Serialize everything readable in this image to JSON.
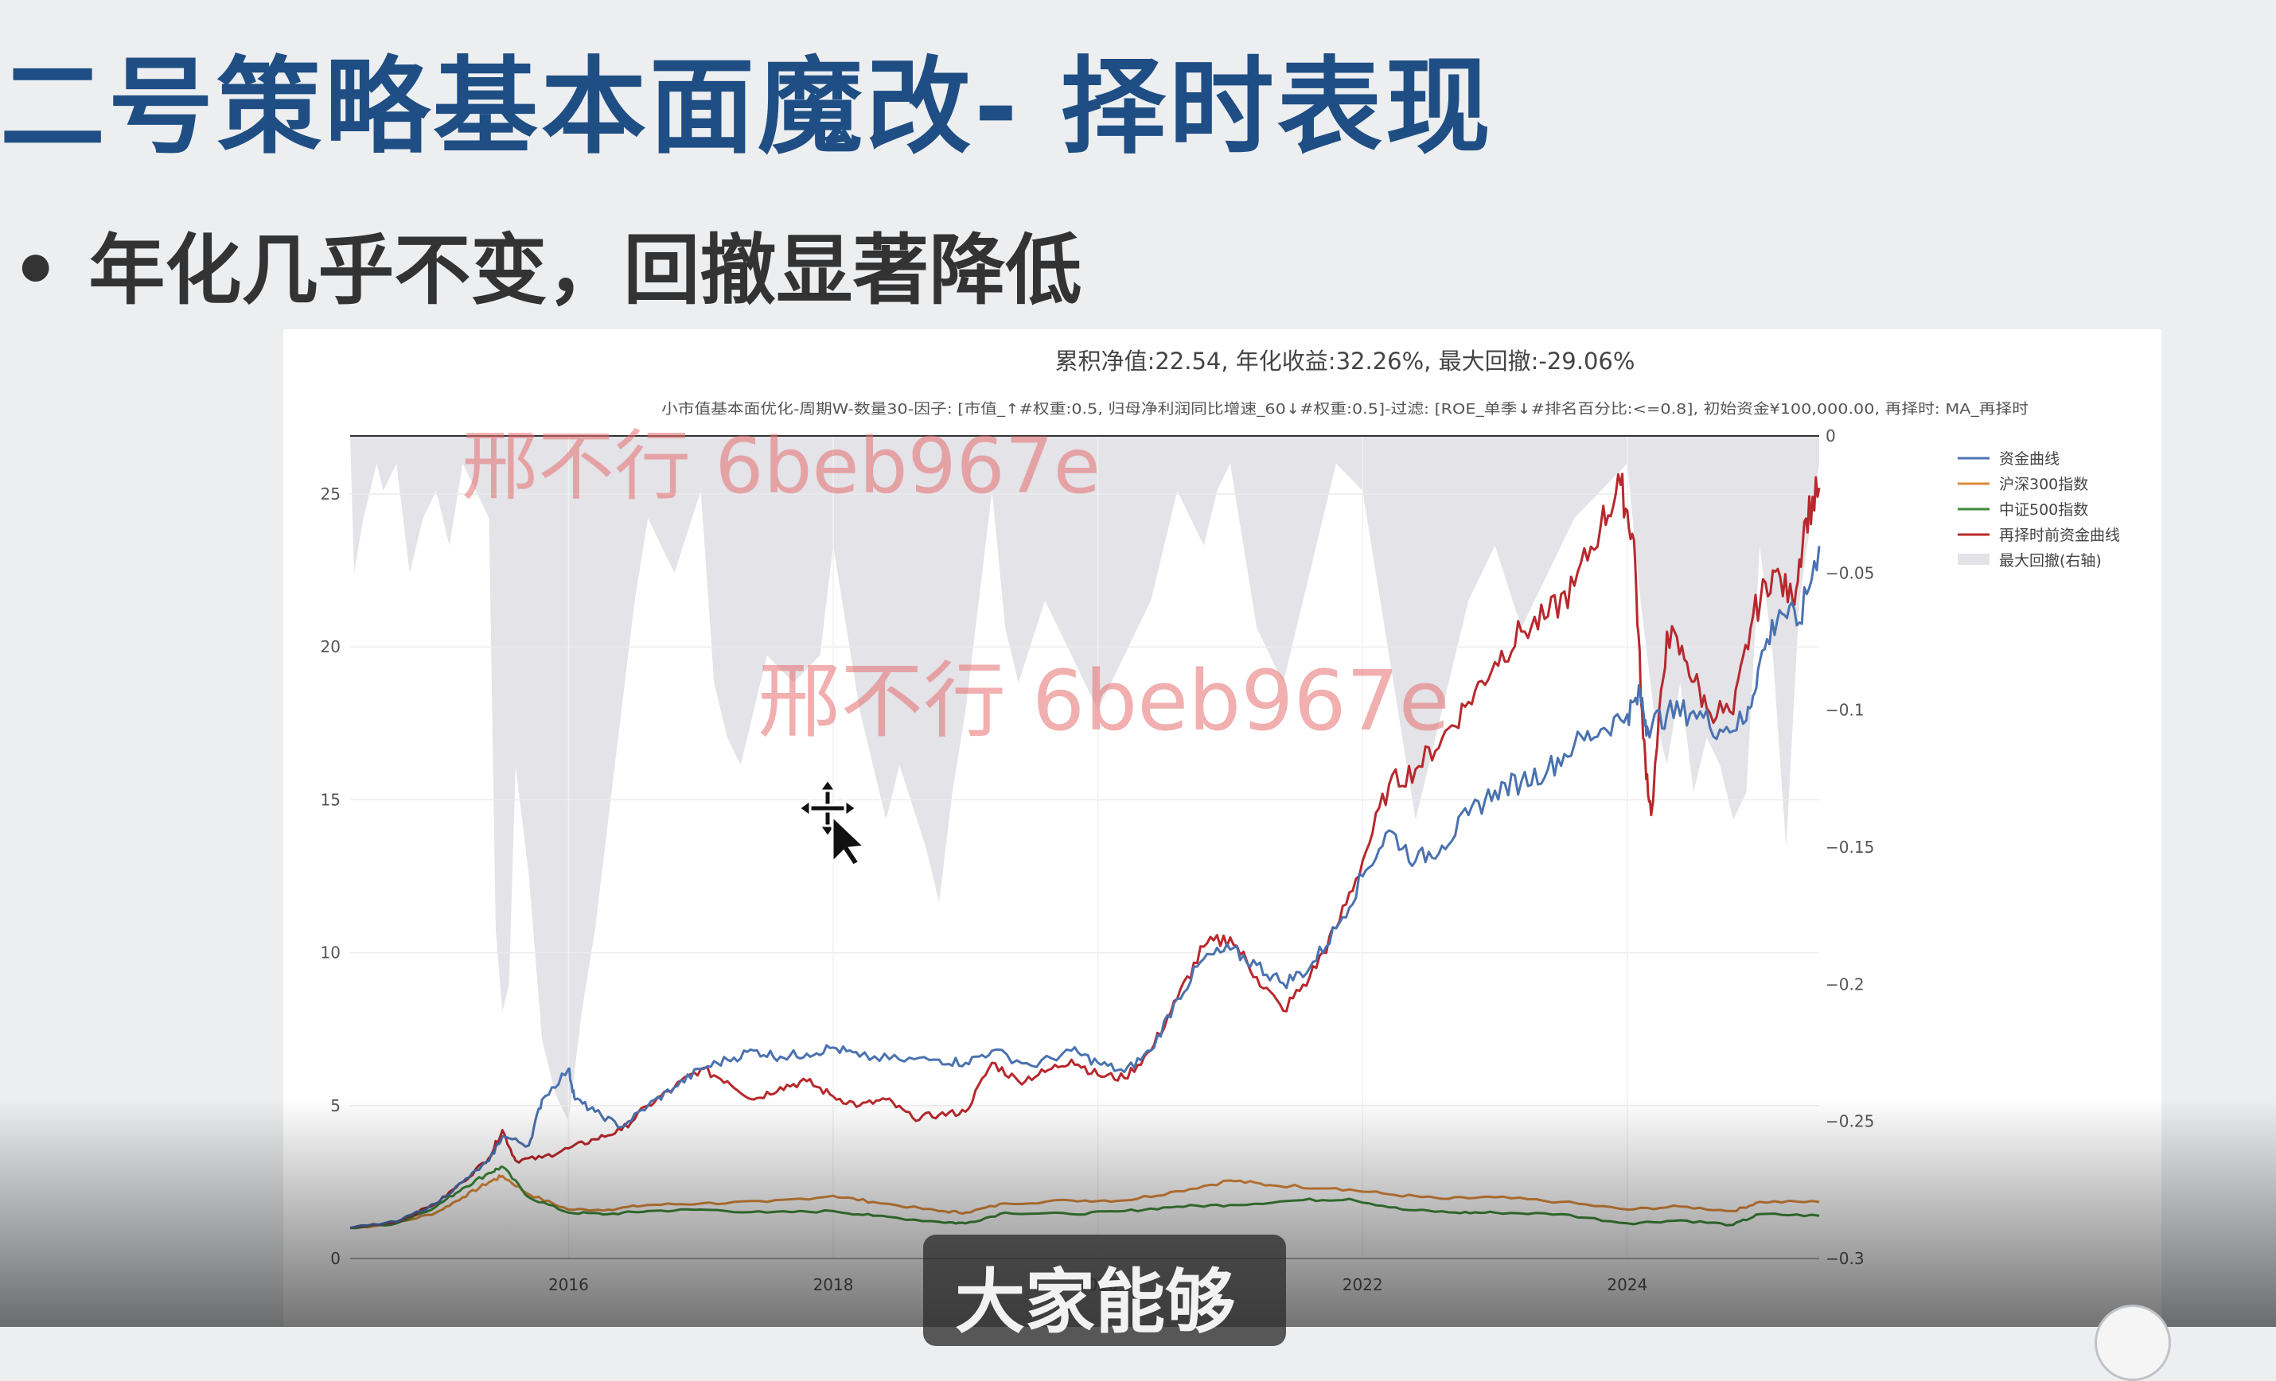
{
  "slide": {
    "title": "二号策略基本面魔改- 择时表现",
    "bullet": "年化几乎不变，回撤显著降低"
  },
  "watermark": "邢不行 6beb967e",
  "caption": "大家能够",
  "icons": {
    "cursor": "move-cursor-icon",
    "bullet": "bullet-dot-icon"
  },
  "chart_data": {
    "type": "line",
    "title": "累积净值:22.54, 年化收益:32.26%, 最大回撤:-29.06%",
    "subtitle": "小市值基本面优化-周期W-数量30-因子: [市值_↑#权重:0.5, 归母净利润同比增速_60↓#权重:0.5]-过滤: [ROE_单季↓#排名百分比:<=0.8], 初始资金¥100,000.00, 再择时: MA_再择时",
    "x_ticks": [
      "2016",
      "2018",
      "2020",
      "2022",
      "2024"
    ],
    "x_range": [
      2014.35,
      2025.45
    ],
    "y_left": {
      "ticks": [
        0,
        5,
        10,
        15,
        20,
        25
      ],
      "range": [
        0,
        26.9
      ]
    },
    "y_right": {
      "ticks": [
        0,
        -0.05,
        -0.1,
        -0.15,
        -0.2,
        -0.25,
        -0.3
      ],
      "range": [
        -0.3,
        0
      ]
    },
    "legend_position": "right",
    "legend": [
      "资金曲线",
      "沪深300指数",
      "中证500指数",
      "再择时前资金曲线",
      "最大回撤(右轴)"
    ],
    "colors": {
      "资金曲线": "#4a72b0",
      "沪深300指数": "#dd8b3c",
      "中证500指数": "#3f8a3a",
      "再择时前资金曲线": "#b8282c",
      "最大回撤(右轴)": "#e3e3e8"
    },
    "series": [
      {
        "name": "资金曲线",
        "axis": "left",
        "points": [
          [
            2014.35,
            1.0
          ],
          [
            2014.7,
            1.2
          ],
          [
            2015.0,
            1.8
          ],
          [
            2015.2,
            2.5
          ],
          [
            2015.4,
            3.2
          ],
          [
            2015.5,
            4.0
          ],
          [
            2015.7,
            3.7
          ],
          [
            2015.8,
            5.2
          ],
          [
            2016.0,
            6.2
          ],
          [
            2016.05,
            5.2
          ],
          [
            2016.2,
            4.8
          ],
          [
            2016.4,
            4.3
          ],
          [
            2016.6,
            5.0
          ],
          [
            2016.8,
            5.6
          ],
          [
            2017.0,
            6.2
          ],
          [
            2017.2,
            6.5
          ],
          [
            2017.4,
            6.8
          ],
          [
            2017.6,
            6.6
          ],
          [
            2017.8,
            6.7
          ],
          [
            2018.0,
            6.9
          ],
          [
            2018.2,
            6.6
          ],
          [
            2018.5,
            6.5
          ],
          [
            2018.8,
            6.5
          ],
          [
            2019.0,
            6.4
          ],
          [
            2019.2,
            6.8
          ],
          [
            2019.5,
            6.3
          ],
          [
            2019.8,
            6.8
          ],
          [
            2020.0,
            6.4
          ],
          [
            2020.2,
            6.1
          ],
          [
            2020.4,
            6.8
          ],
          [
            2020.6,
            8.5
          ],
          [
            2020.8,
            9.8
          ],
          [
            2021.0,
            10.1
          ],
          [
            2021.2,
            9.6
          ],
          [
            2021.4,
            9.0
          ],
          [
            2021.6,
            9.5
          ],
          [
            2021.8,
            10.8
          ],
          [
            2022.0,
            12.5
          ],
          [
            2022.2,
            14.0
          ],
          [
            2022.4,
            13.0
          ],
          [
            2022.6,
            13.5
          ],
          [
            2022.8,
            14.5
          ],
          [
            2023.0,
            15.3
          ],
          [
            2023.2,
            15.6
          ],
          [
            2023.4,
            16.0
          ],
          [
            2023.6,
            16.8
          ],
          [
            2023.8,
            17.3
          ],
          [
            2024.0,
            17.8
          ],
          [
            2024.1,
            18.4
          ],
          [
            2024.15,
            17.4
          ],
          [
            2024.3,
            17.8
          ],
          [
            2024.5,
            17.9
          ],
          [
            2024.7,
            17.3
          ],
          [
            2024.9,
            17.6
          ],
          [
            2025.0,
            19.5
          ],
          [
            2025.15,
            21.2
          ],
          [
            2025.3,
            20.8
          ],
          [
            2025.45,
            23.3
          ]
        ]
      },
      {
        "name": "再择时前资金曲线",
        "axis": "left",
        "points": [
          [
            2014.35,
            1.0
          ],
          [
            2014.7,
            1.2
          ],
          [
            2015.0,
            1.8
          ],
          [
            2015.2,
            2.5
          ],
          [
            2015.4,
            3.3
          ],
          [
            2015.5,
            4.2
          ],
          [
            2015.6,
            3.2
          ],
          [
            2015.8,
            3.3
          ],
          [
            2016.0,
            3.6
          ],
          [
            2016.2,
            3.9
          ],
          [
            2016.4,
            4.2
          ],
          [
            2016.6,
            5.0
          ],
          [
            2016.8,
            5.6
          ],
          [
            2017.0,
            6.2
          ],
          [
            2017.2,
            5.8
          ],
          [
            2017.4,
            5.2
          ],
          [
            2017.6,
            5.6
          ],
          [
            2017.8,
            5.8
          ],
          [
            2018.0,
            5.3
          ],
          [
            2018.2,
            5.0
          ],
          [
            2018.4,
            5.2
          ],
          [
            2018.6,
            4.6
          ],
          [
            2018.8,
            4.7
          ],
          [
            2019.0,
            4.8
          ],
          [
            2019.2,
            6.4
          ],
          [
            2019.4,
            5.8
          ],
          [
            2019.6,
            6.1
          ],
          [
            2019.8,
            6.5
          ],
          [
            2020.0,
            6.0
          ],
          [
            2020.2,
            5.9
          ],
          [
            2020.4,
            6.8
          ],
          [
            2020.6,
            8.5
          ],
          [
            2020.8,
            10.2
          ],
          [
            2021.0,
            10.5
          ],
          [
            2021.2,
            9.2
          ],
          [
            2021.4,
            8.1
          ],
          [
            2021.6,
            9.2
          ],
          [
            2021.8,
            10.8
          ],
          [
            2022.0,
            13.0
          ],
          [
            2022.2,
            15.5
          ],
          [
            2022.4,
            16.0
          ],
          [
            2022.6,
            17.0
          ],
          [
            2022.8,
            18.2
          ],
          [
            2023.0,
            19.5
          ],
          [
            2023.2,
            20.5
          ],
          [
            2023.4,
            21.0
          ],
          [
            2023.6,
            22.0
          ],
          [
            2023.8,
            24.0
          ],
          [
            2023.95,
            25.3
          ],
          [
            2024.05,
            23.5
          ],
          [
            2024.12,
            17.0
          ],
          [
            2024.18,
            14.5
          ],
          [
            2024.3,
            20.5
          ],
          [
            2024.45,
            19.5
          ],
          [
            2024.6,
            18.0
          ],
          [
            2024.8,
            17.8
          ],
          [
            2024.95,
            21.0
          ],
          [
            2025.1,
            22.5
          ],
          [
            2025.25,
            21.5
          ],
          [
            2025.35,
            24.2
          ],
          [
            2025.45,
            25.2
          ]
        ]
      },
      {
        "name": "沪深300指数",
        "axis": "left",
        "points": [
          [
            2014.35,
            1.0
          ],
          [
            2014.7,
            1.15
          ],
          [
            2015.0,
            1.5
          ],
          [
            2015.2,
            2.0
          ],
          [
            2015.4,
            2.5
          ],
          [
            2015.5,
            2.7
          ],
          [
            2015.7,
            2.1
          ],
          [
            2016.0,
            1.6
          ],
          [
            2016.3,
            1.6
          ],
          [
            2016.6,
            1.75
          ],
          [
            2017.0,
            1.8
          ],
          [
            2017.5,
            1.85
          ],
          [
            2018.0,
            2.05
          ],
          [
            2018.3,
            1.85
          ],
          [
            2018.8,
            1.55
          ],
          [
            2019.0,
            1.5
          ],
          [
            2019.3,
            1.8
          ],
          [
            2019.8,
            1.9
          ],
          [
            2020.2,
            1.9
          ],
          [
            2020.6,
            2.2
          ],
          [
            2021.0,
            2.55
          ],
          [
            2021.3,
            2.4
          ],
          [
            2021.8,
            2.3
          ],
          [
            2022.2,
            2.1
          ],
          [
            2022.6,
            1.95
          ],
          [
            2023.0,
            2.0
          ],
          [
            2023.5,
            1.85
          ],
          [
            2024.0,
            1.6
          ],
          [
            2024.4,
            1.7
          ],
          [
            2024.8,
            1.55
          ],
          [
            2025.0,
            1.85
          ],
          [
            2025.45,
            1.85
          ]
        ]
      },
      {
        "name": "中证500指数",
        "axis": "left",
        "points": [
          [
            2014.35,
            1.0
          ],
          [
            2014.7,
            1.15
          ],
          [
            2015.0,
            1.7
          ],
          [
            2015.2,
            2.3
          ],
          [
            2015.4,
            2.8
          ],
          [
            2015.5,
            3.0
          ],
          [
            2015.7,
            2.0
          ],
          [
            2016.0,
            1.5
          ],
          [
            2016.3,
            1.45
          ],
          [
            2016.6,
            1.55
          ],
          [
            2017.0,
            1.6
          ],
          [
            2017.5,
            1.5
          ],
          [
            2018.0,
            1.55
          ],
          [
            2018.3,
            1.4
          ],
          [
            2018.8,
            1.2
          ],
          [
            2019.0,
            1.15
          ],
          [
            2019.3,
            1.5
          ],
          [
            2019.8,
            1.45
          ],
          [
            2020.2,
            1.55
          ],
          [
            2020.6,
            1.7
          ],
          [
            2021.0,
            1.75
          ],
          [
            2021.5,
            1.9
          ],
          [
            2021.9,
            1.95
          ],
          [
            2022.3,
            1.6
          ],
          [
            2022.7,
            1.5
          ],
          [
            2023.0,
            1.5
          ],
          [
            2023.5,
            1.45
          ],
          [
            2024.0,
            1.15
          ],
          [
            2024.4,
            1.25
          ],
          [
            2024.8,
            1.1
          ],
          [
            2025.0,
            1.45
          ],
          [
            2025.45,
            1.4
          ]
        ]
      }
    ],
    "drawdown": [
      [
        2014.35,
        0
      ],
      [
        2014.38,
        -0.05
      ],
      [
        2014.45,
        -0.03
      ],
      [
        2014.55,
        -0.01
      ],
      [
        2014.6,
        -0.02
      ],
      [
        2014.7,
        -0.01
      ],
      [
        2014.8,
        -0.05
      ],
      [
        2014.9,
        -0.03
      ],
      [
        2015.0,
        -0.02
      ],
      [
        2015.1,
        -0.04
      ],
      [
        2015.2,
        -0.01
      ],
      [
        2015.3,
        -0.02
      ],
      [
        2015.4,
        -0.03
      ],
      [
        2015.45,
        -0.18
      ],
      [
        2015.5,
        -0.21
      ],
      [
        2015.55,
        -0.2
      ],
      [
        2015.6,
        -0.12
      ],
      [
        2015.7,
        -0.16
      ],
      [
        2015.8,
        -0.22
      ],
      [
        2015.9,
        -0.24
      ],
      [
        2016.0,
        -0.25
      ],
      [
        2016.1,
        -0.21
      ],
      [
        2016.2,
        -0.18
      ],
      [
        2016.3,
        -0.14
      ],
      [
        2016.4,
        -0.1
      ],
      [
        2016.5,
        -0.06
      ],
      [
        2016.6,
        -0.03
      ],
      [
        2016.8,
        -0.05
      ],
      [
        2017.0,
        -0.02
      ],
      [
        2017.1,
        -0.09
      ],
      [
        2017.2,
        -0.11
      ],
      [
        2017.3,
        -0.12
      ],
      [
        2017.5,
        -0.08
      ],
      [
        2017.7,
        -0.09
      ],
      [
        2017.9,
        -0.08
      ],
      [
        2018.0,
        -0.04
      ],
      [
        2018.2,
        -0.1
      ],
      [
        2018.4,
        -0.14
      ],
      [
        2018.5,
        -0.12
      ],
      [
        2018.7,
        -0.15
      ],
      [
        2018.8,
        -0.17
      ],
      [
        2018.9,
        -0.13
      ],
      [
        2019.0,
        -0.1
      ],
      [
        2019.2,
        -0.02
      ],
      [
        2019.3,
        -0.07
      ],
      [
        2019.4,
        -0.09
      ],
      [
        2019.6,
        -0.06
      ],
      [
        2019.8,
        -0.08
      ],
      [
        2020.0,
        -0.1
      ],
      [
        2020.2,
        -0.08
      ],
      [
        2020.4,
        -0.06
      ],
      [
        2020.6,
        -0.02
      ],
      [
        2020.8,
        -0.04
      ],
      [
        2020.9,
        -0.02
      ],
      [
        2021.0,
        -0.01
      ],
      [
        2021.2,
        -0.07
      ],
      [
        2021.4,
        -0.09
      ],
      [
        2021.6,
        -0.05
      ],
      [
        2021.8,
        -0.01
      ],
      [
        2022.0,
        -0.02
      ],
      [
        2022.2,
        -0.08
      ],
      [
        2022.4,
        -0.14
      ],
      [
        2022.5,
        -0.12
      ],
      [
        2022.6,
        -0.1
      ],
      [
        2022.8,
        -0.06
      ],
      [
        2023.0,
        -0.04
      ],
      [
        2023.2,
        -0.07
      ],
      [
        2023.4,
        -0.05
      ],
      [
        2023.6,
        -0.03
      ],
      [
        2023.8,
        -0.02
      ],
      [
        2024.0,
        -0.01
      ],
      [
        2024.1,
        -0.06
      ],
      [
        2024.2,
        -0.1
      ],
      [
        2024.3,
        -0.12
      ],
      [
        2024.4,
        -0.09
      ],
      [
        2024.5,
        -0.13
      ],
      [
        2024.6,
        -0.11
      ],
      [
        2024.7,
        -0.12
      ],
      [
        2024.8,
        -0.14
      ],
      [
        2024.9,
        -0.13
      ],
      [
        2025.0,
        -0.04
      ],
      [
        2025.1,
        -0.08
      ],
      [
        2025.2,
        -0.15
      ],
      [
        2025.3,
        -0.06
      ],
      [
        2025.45,
        -0.01
      ]
    ]
  }
}
